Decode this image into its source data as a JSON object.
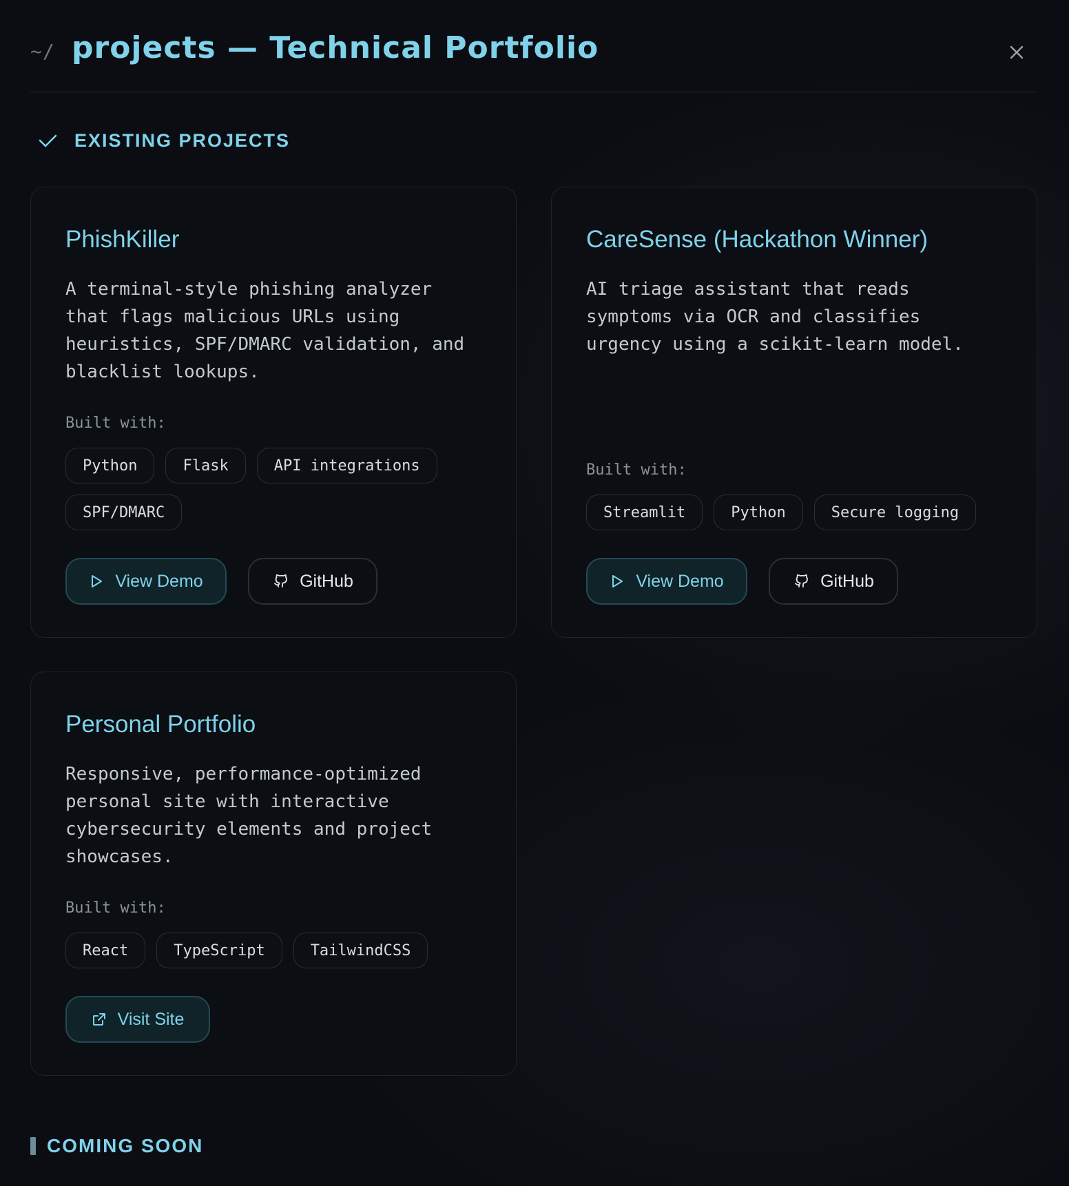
{
  "header": {
    "prompt": "~/",
    "title": "projects — Technical Portfolio"
  },
  "existing": {
    "heading": "EXISTING PROJECTS"
  },
  "projects": [
    {
      "title": "PhishKiller",
      "description": "A terminal-style phishing analyzer that flags malicious URLs using heuristics, SPF/DMARC validation, and blacklist lookups.",
      "built_label": "Built with:",
      "tags": [
        "Python",
        "Flask",
        "API integrations",
        "SPF/DMARC"
      ],
      "demo_label": "View Demo",
      "github_label": "GitHub"
    },
    {
      "title": "CareSense (Hackathon Winner)",
      "description": "AI triage assistant that reads symptoms via OCR and classifies urgency using a scikit-learn model.",
      "built_label": "Built with:",
      "tags": [
        "Streamlit",
        "Python",
        "Secure logging"
      ],
      "demo_label": "View Demo",
      "github_label": "GitHub"
    },
    {
      "title": "Personal Portfolio",
      "description": "Responsive, performance-optimized personal site with interactive cybersecurity elements and project showcases.",
      "built_label": "Built with:",
      "tags": [
        "React",
        "TypeScript",
        "TailwindCSS"
      ],
      "visit_label": "Visit Site"
    }
  ],
  "coming_soon": {
    "heading": "COMING SOON"
  },
  "icons": {
    "close": "close-icon",
    "check": "check-icon",
    "play": "play-icon",
    "github": "github-icon",
    "external": "external-link-icon"
  },
  "colors": {
    "accent": "#7fd2ea",
    "background": "#0b0d12",
    "card_border": "#1f222a"
  }
}
